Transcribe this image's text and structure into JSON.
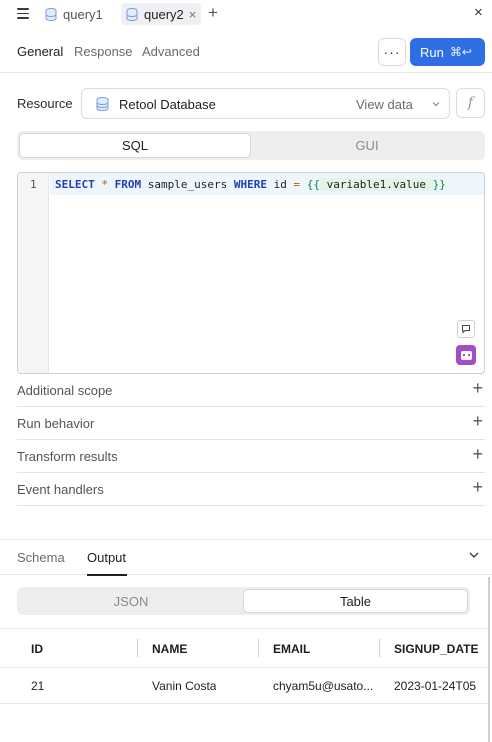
{
  "tabs": {
    "menu_icon": "hamburger-icon",
    "items": [
      {
        "label": "query1",
        "icon": "database-icon",
        "active": false
      },
      {
        "label": "query2",
        "icon": "database-icon",
        "active": true
      }
    ],
    "close_icon": "×",
    "add_icon": "+",
    "close_all_icon": "×"
  },
  "section_tabs": {
    "items": [
      "General",
      "Response",
      "Advanced"
    ],
    "active": "General",
    "more_label": "···",
    "run_label": "Run",
    "run_shortcut": "⌘↩"
  },
  "resource": {
    "label": "Resource",
    "value": "Retool Database",
    "view_data": "View data",
    "fx_label": "f"
  },
  "mode_toggle": {
    "options": [
      "SQL",
      "GUI"
    ],
    "selected": "SQL"
  },
  "editor": {
    "line_number": "1",
    "tokens": {
      "select": "SELECT",
      "star": "*",
      "from": "FROM",
      "table": "sample_users",
      "where": "WHERE",
      "col": "id",
      "eq": "=",
      "open": "{{",
      "var": "variable1",
      "dot": ".",
      "prop": "value",
      "close": "}}"
    }
  },
  "accordion": [
    {
      "label": "Additional scope"
    },
    {
      "label": "Run behavior"
    },
    {
      "label": "Transform results"
    },
    {
      "label": "Event handlers"
    }
  ],
  "bottom": {
    "tabs": [
      "Schema",
      "Output"
    ],
    "active": "Output",
    "view_options": [
      "JSON",
      "Table"
    ],
    "view_selected": "Table"
  },
  "table": {
    "columns": [
      "ID",
      "NAME",
      "EMAIL",
      "SIGNUP_DATE"
    ],
    "rows": [
      [
        "21",
        "Vanin Costa",
        "chyam5u@usato...",
        "2023-01-24T05"
      ]
    ]
  },
  "colors": {
    "run_button": "#2f6fe4",
    "assistant_icon": "#a64bc9",
    "keyword": "#1f3fb5",
    "template": "#0a8a3a"
  }
}
